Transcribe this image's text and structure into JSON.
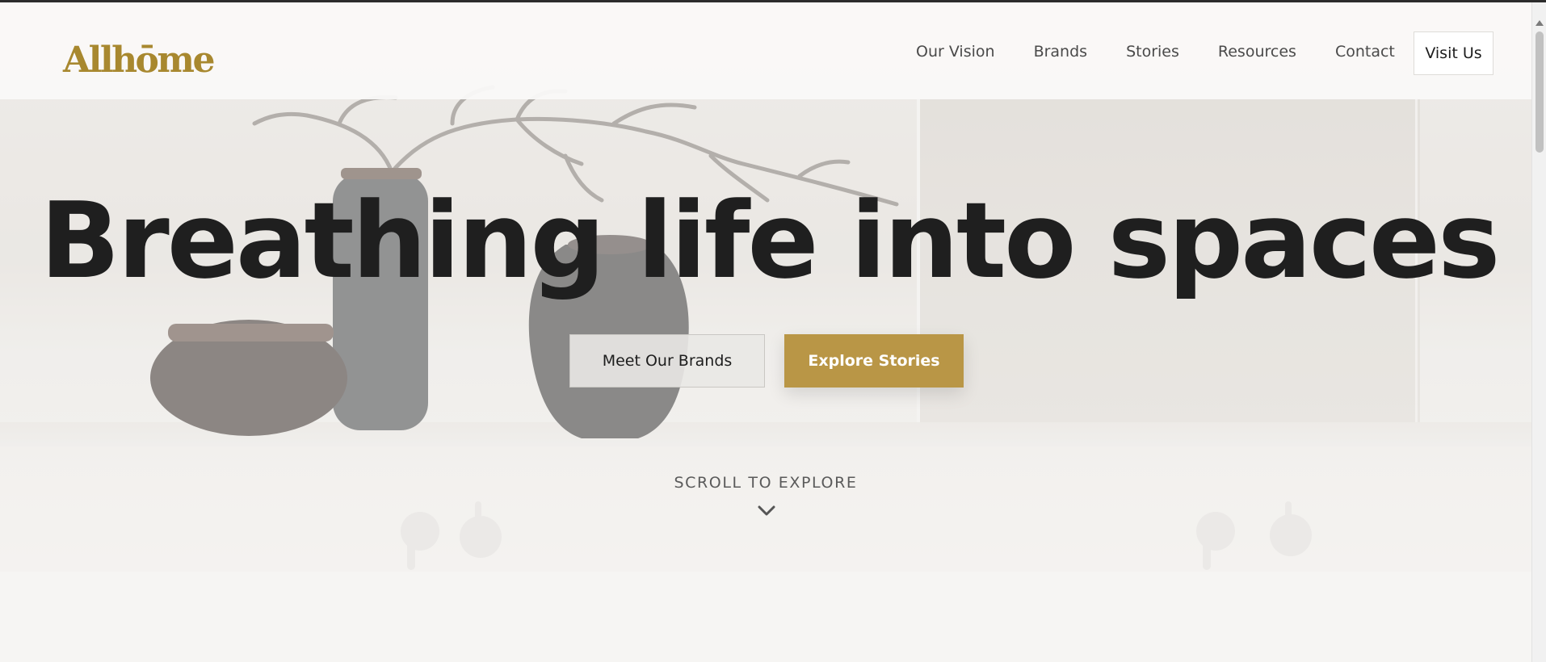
{
  "header": {
    "logo_text": "Allhōme",
    "nav_items": [
      {
        "label": "Our Vision"
      },
      {
        "label": "Brands"
      },
      {
        "label": "Stories"
      },
      {
        "label": "Resources"
      },
      {
        "label": "Contact"
      }
    ],
    "visit_label": "Visit Us"
  },
  "hero": {
    "headline": "Breathing life into spaces",
    "primary_cta": "Meet Our Brands",
    "secondary_cta": "Explore Stories",
    "scroll_hint": "SCROLL TO EXPLORE",
    "scroll_icon": "chevron-down-icon"
  },
  "colors": {
    "brand_gold": "#b99646",
    "logo_gold": "#a8882f",
    "text_dark": "#1f1f1f",
    "background": "#f6f5f3"
  }
}
